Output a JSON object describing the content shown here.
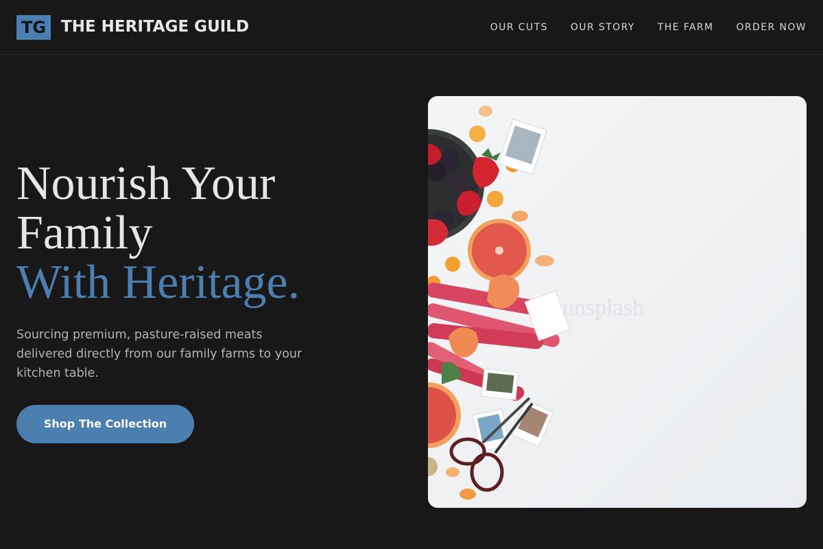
{
  "brand": {
    "badge": "TG",
    "name": "THE HERITAGE GUILD",
    "accent_color": "#4a7fb0"
  },
  "nav": {
    "items": [
      "OUR CUTS",
      "OUR STORY",
      "THE FARM",
      "ORDER NOW"
    ]
  },
  "hero": {
    "headline_line1": "Nourish Your",
    "headline_line2": "Family",
    "headline_line3": "With Heritage.",
    "subtext": "Sourcing premium, pasture-raised meats delivered directly from our family farms to your kitchen table.",
    "cta_label": "Shop The Collection",
    "image_watermark": "unsplash"
  }
}
